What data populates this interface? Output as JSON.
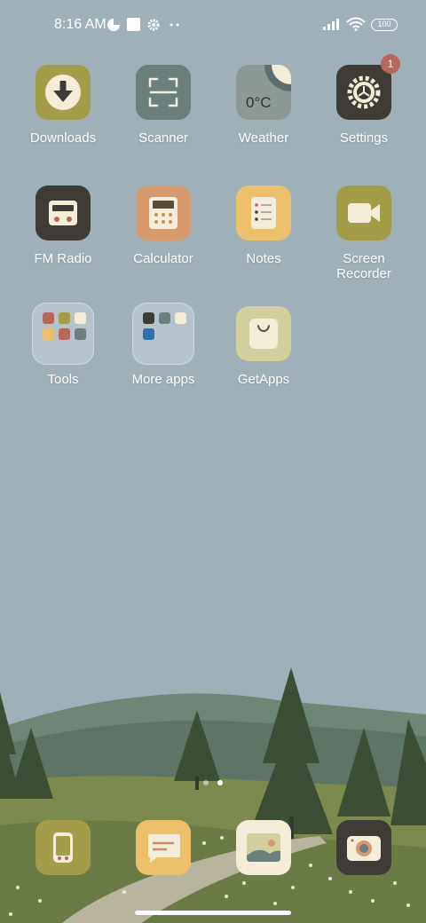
{
  "status_bar": {
    "time": "8:16 AM",
    "battery": "100",
    "icons": [
      "data-saver-icon",
      "square-notification-icon",
      "gear-icon",
      "more-dots-icon",
      "signal-icon",
      "wifi-icon",
      "battery-icon"
    ]
  },
  "apps": [
    {
      "label": "Downloads",
      "icon": "download-icon"
    },
    {
      "label": "Scanner",
      "icon": "scan-icon"
    },
    {
      "label": "Weather",
      "icon": "weather-icon",
      "tile_text": "0°C"
    },
    {
      "label": "Settings",
      "icon": "gear-icon",
      "badge": "1"
    },
    {
      "label": "FM Radio",
      "icon": "radio-icon"
    },
    {
      "label": "Calculator",
      "icon": "calculator-icon"
    },
    {
      "label": "Notes",
      "icon": "notes-icon"
    },
    {
      "label": "Screen\nRecorder",
      "icon": "video-camera-icon"
    },
    {
      "label": "Tools",
      "icon": "folder-icon"
    },
    {
      "label": "More apps",
      "icon": "folder-icon"
    },
    {
      "label": "GetApps",
      "icon": "shopping-bag-icon"
    }
  ],
  "dock": [
    {
      "name": "phone",
      "icon": "phone-icon"
    },
    {
      "name": "messages",
      "icon": "message-icon"
    },
    {
      "name": "gallery",
      "icon": "gallery-icon"
    },
    {
      "name": "camera",
      "icon": "camera-icon"
    }
  ],
  "page_indicator": {
    "pages": 2,
    "current": 2
  },
  "colors": {
    "sky": "#9fb0b8",
    "olive": "#a39d4a",
    "slate": "#6b7f7c",
    "dark": "#3f3c38",
    "peach": "#d79a6c",
    "sand": "#ecc06a",
    "cream": "#f2ecd9"
  }
}
